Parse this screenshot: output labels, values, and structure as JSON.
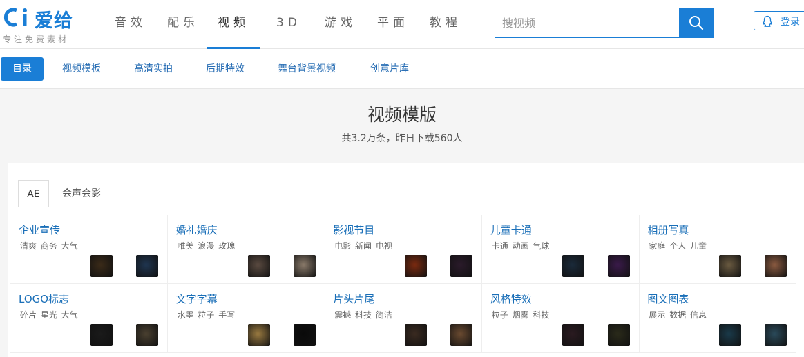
{
  "brand": {
    "name": "爱给",
    "tagline": "专注免费素材"
  },
  "nav": [
    {
      "label": "音效",
      "active": false
    },
    {
      "label": "配乐",
      "active": false
    },
    {
      "label": "视频",
      "active": true
    },
    {
      "label": "3D",
      "active": false
    },
    {
      "label": "游戏",
      "active": false
    },
    {
      "label": "平面",
      "active": false
    },
    {
      "label": "教程",
      "active": false
    }
  ],
  "search": {
    "placeholder": "搜视频",
    "icon": "search-icon"
  },
  "login": {
    "label": "登录",
    "icon": "qq-penguin-icon"
  },
  "subnav": [
    {
      "label": "目录",
      "active": true
    },
    {
      "label": "视频模板",
      "active": false
    },
    {
      "label": "高清实拍",
      "active": false
    },
    {
      "label": "后期特效",
      "active": false
    },
    {
      "label": "舞台背景视频",
      "active": false
    },
    {
      "label": "创意片库",
      "active": false
    }
  ],
  "heading": {
    "title": "视频模版",
    "stats": "共3.2万条，昨日下载560人"
  },
  "tabs": [
    {
      "label": "AE",
      "active": true
    },
    {
      "label": "会声会影",
      "active": false
    }
  ],
  "categories": [
    {
      "title": "企业宣传",
      "tags": "清爽 商务 大气"
    },
    {
      "title": "婚礼婚庆",
      "tags": "唯美 浪漫 玫瑰"
    },
    {
      "title": "影视节目",
      "tags": "电影 新闻 电视"
    },
    {
      "title": "儿童卡通",
      "tags": "卡通 动画 气球"
    },
    {
      "title": "相册写真",
      "tags": "家庭 个人 儿童"
    },
    {
      "title": "LOGO标志",
      "tags": "碎片 星光 大气"
    },
    {
      "title": "文字字幕",
      "tags": "水墨 粒子 手写"
    },
    {
      "title": "片头片尾",
      "tags": "震撼 科技 简洁"
    },
    {
      "title": "风格特效",
      "tags": "粒子 烟雾 科技"
    },
    {
      "title": "图文图表",
      "tags": "展示 数据 信息"
    }
  ],
  "thumb_colors": [
    [
      "#3a2a18",
      "#1f3550"
    ],
    [
      "#5a4a40",
      "#8a7a6a"
    ],
    [
      "#7a2a10",
      "#2a1a2a"
    ],
    [
      "#1a2a3a",
      "#3a1a4a"
    ],
    [
      "#6a5a40",
      "#8a5a40"
    ],
    [
      "#1a1a1a",
      "#4a4030"
    ],
    [
      "#9a7a40",
      "#0a0a0a"
    ],
    [
      "#3a2a20",
      "#6a4a30"
    ],
    [
      "#2a1a20",
      "#2a2a1a"
    ],
    [
      "#1a3a4a",
      "#2a4a5a"
    ]
  ],
  "accent": "#1a7ed6"
}
